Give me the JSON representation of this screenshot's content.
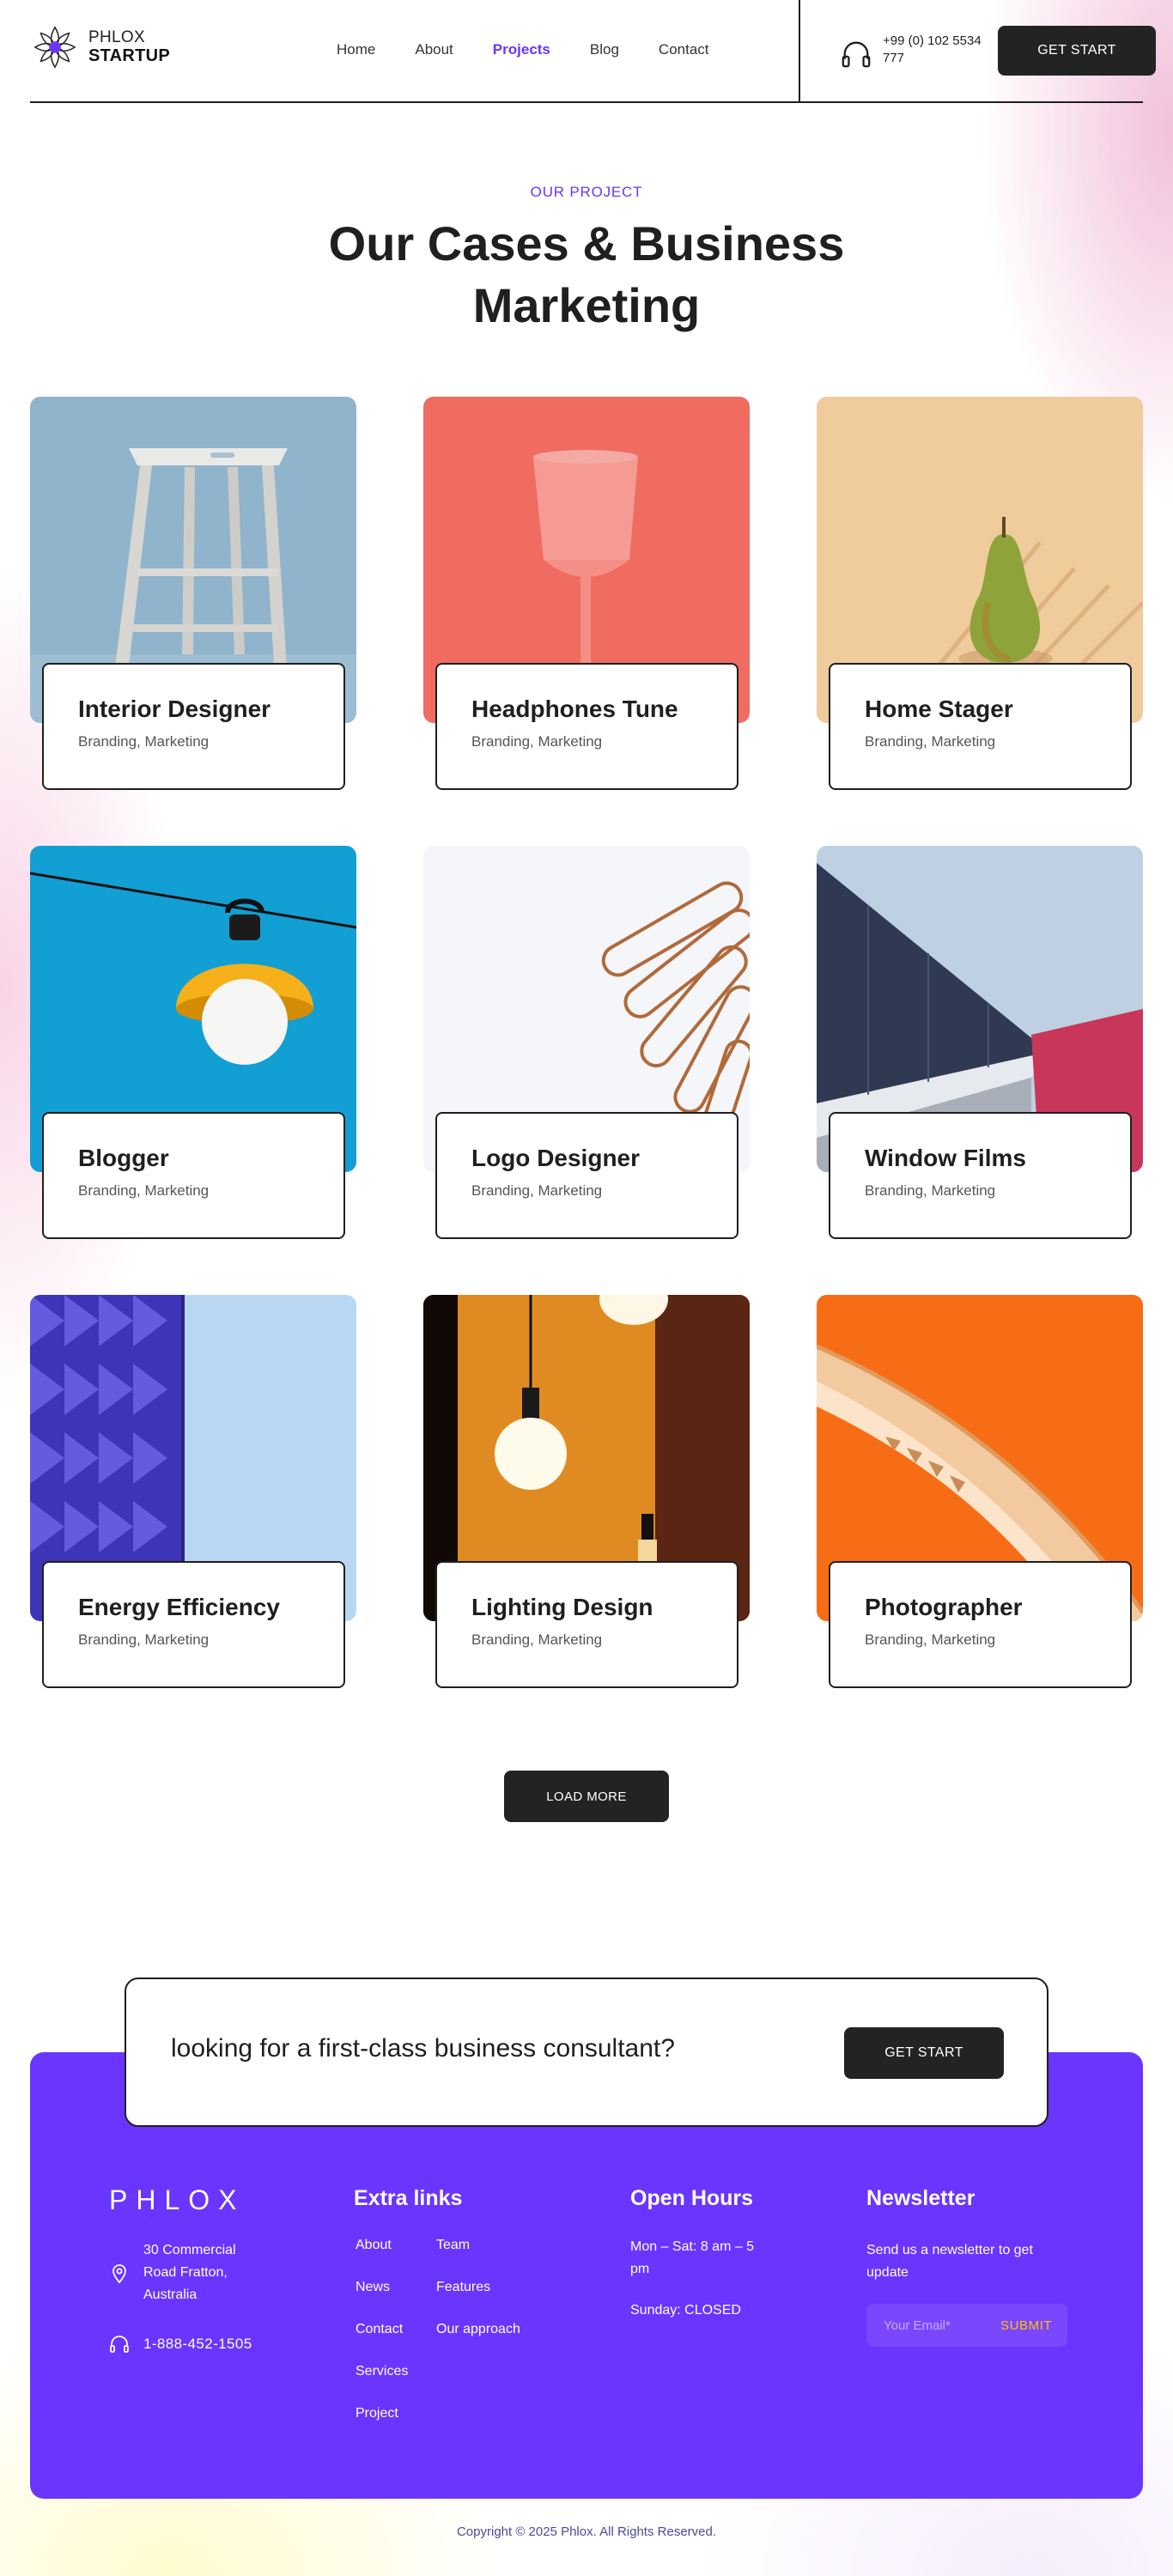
{
  "header": {
    "logo_top": "PHLOX",
    "logo_bottom": "STARTUP",
    "nav": [
      {
        "label": "Home",
        "active": false
      },
      {
        "label": "About",
        "active": false
      },
      {
        "label": "Projects",
        "active": true
      },
      {
        "label": "Blog",
        "active": false
      },
      {
        "label": "Contact",
        "active": false
      }
    ],
    "phone": "+99 (0) 102 5534 777",
    "cta_label": "GET START"
  },
  "hero": {
    "eyebrow": "OUR PROJECT",
    "title": "Our Cases & Business Marketing"
  },
  "projects": [
    {
      "title": "Interior Designer",
      "tags": "Branding,  Marketing",
      "image": "stool"
    },
    {
      "title": "Headphones Tune",
      "tags": "Branding,  Marketing",
      "image": "glass"
    },
    {
      "title": "Home Stager",
      "tags": "Branding,  Marketing",
      "image": "pear"
    },
    {
      "title": "Blogger",
      "tags": "Branding,  Marketing",
      "image": "lamp"
    },
    {
      "title": "Logo Designer",
      "tags": "Branding,  Marketing",
      "image": "paperclips"
    },
    {
      "title": "Window Films",
      "tags": "Branding,  Marketing",
      "image": "building"
    },
    {
      "title": "Energy Efficiency",
      "tags": "Branding,  Marketing",
      "image": "facade"
    },
    {
      "title": "Lighting Design",
      "tags": "Branding,  Marketing",
      "image": "bulb"
    },
    {
      "title": "Photographer",
      "tags": "Branding,  Marketing",
      "image": "stairs"
    }
  ],
  "load_more_label": "LOAD MORE",
  "cta": {
    "text": "looking for a first-class business consultant?",
    "button_label": "GET START"
  },
  "footer": {
    "logo": "PHLOX",
    "address": "30 Commercial Road Fratton, Australia",
    "phone": "1-888-452-1505",
    "extra_links_heading": "Extra links",
    "links_col1": [
      "About",
      "News",
      "Contact",
      "Services",
      "Project"
    ],
    "links_col2": [
      "Team",
      "Features",
      "Our approach"
    ],
    "hours_heading": "Open Hours",
    "hours_weekday": "Mon – Sat: 8 am – 5 pm",
    "hours_sunday": "Sunday: CLOSED",
    "newsletter_heading": "Newsletter",
    "newsletter_text": "Send us a newsletter to get update",
    "email_placeholder": "Your Email*",
    "submit_label": "SUBMIT"
  },
  "copyright": "Copyright © 2025 Phlox. All Rights Reserved.",
  "colors": {
    "accent": "#6a35ff",
    "dark": "#232323",
    "submit": "#ffc400"
  }
}
